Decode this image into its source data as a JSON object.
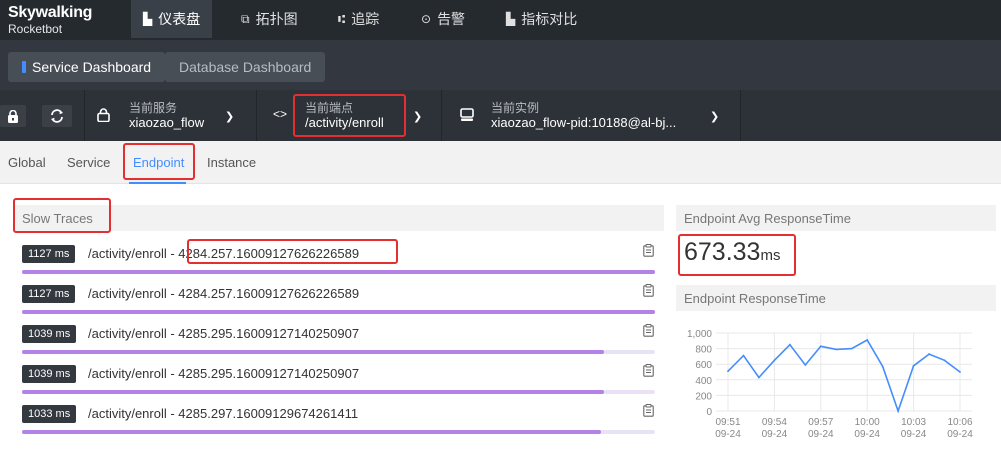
{
  "app": {
    "name": "Skywalking",
    "sub": "Rocketbot"
  },
  "nav": [
    {
      "label": "仪表盘",
      "icon": "dashboard-icon",
      "glyph": "▙",
      "active": true
    },
    {
      "label": "拓扑图",
      "icon": "topology-icon",
      "glyph": "⧉",
      "active": false
    },
    {
      "label": "追踪",
      "icon": "trace-icon",
      "glyph": "⑆",
      "active": false
    },
    {
      "label": "告警",
      "icon": "alarm-icon",
      "glyph": "⊙",
      "active": false
    },
    {
      "label": "指标对比",
      "icon": "compare-icon",
      "glyph": "▙",
      "active": false
    }
  ],
  "dashboards": [
    {
      "label": "Service Dashboard",
      "active": true
    },
    {
      "label": "Database Dashboard",
      "active": false
    }
  ],
  "toolbar": {
    "lock_icon": "lock-icon",
    "refresh_icon": "refresh-icon",
    "service": {
      "label": "当前服务",
      "value": "xiaozao_flow"
    },
    "endpoint": {
      "label": "当前端点",
      "value": "/activity/enroll"
    },
    "instance": {
      "label": "当前实例",
      "value": "xiaozao_flow-pid:10188@al-bj..."
    }
  },
  "tabs": [
    "Global",
    "Service",
    "Endpoint",
    "Instance"
  ],
  "active_tab": "Endpoint",
  "slow_traces": {
    "title": "Slow Traces",
    "items": [
      {
        "duration": "1127 ms",
        "name": "/activity/enroll - 4284.257.16009127626226589",
        "ratio": 1.0
      },
      {
        "duration": "1127 ms",
        "name": "/activity/enroll - 4284.257.16009127626226589",
        "ratio": 1.0
      },
      {
        "duration": "1039 ms",
        "name": "/activity/enroll - 4285.295.16009127140250907",
        "ratio": 0.92
      },
      {
        "duration": "1039 ms",
        "name": "/activity/enroll - 4285.295.16009127140250907",
        "ratio": 0.92
      },
      {
        "duration": "1033 ms",
        "name": "/activity/enroll - 4285.297.16009129674261411",
        "ratio": 0.915
      }
    ]
  },
  "avg_panel": {
    "title": "Endpoint Avg ResponseTime",
    "value": "673.33",
    "unit": "ms"
  },
  "rt_panel": {
    "title": "Endpoint ResponseTime"
  },
  "chart_data": {
    "type": "line",
    "x": [
      "09:51",
      "09:52",
      "09:53",
      "09:54",
      "09:55",
      "09:56",
      "09:57",
      "09:58",
      "09:59",
      "10:00",
      "10:01",
      "10:02",
      "10:03",
      "10:04",
      "10:05",
      "10:06"
    ],
    "x_tick_labels": [
      {
        "time": "09:51",
        "date": "09-24"
      },
      {
        "time": "09:54",
        "date": "09-24"
      },
      {
        "time": "09:57",
        "date": "09-24"
      },
      {
        "time": "10:00",
        "date": "09-24"
      },
      {
        "time": "10:03",
        "date": "09-24"
      },
      {
        "time": "10:06",
        "date": "09-24"
      }
    ],
    "series": [
      {
        "values": [
          510,
          710,
          430,
          650,
          850,
          590,
          830,
          790,
          800,
          910,
          570,
          0,
          580,
          730,
          650,
          500
        ]
      }
    ],
    "ylim": [
      0,
      1000
    ],
    "yticks": [
      "1,000",
      "800",
      "600",
      "400",
      "200",
      "0"
    ],
    "grid": true,
    "color": "#448dfe"
  }
}
